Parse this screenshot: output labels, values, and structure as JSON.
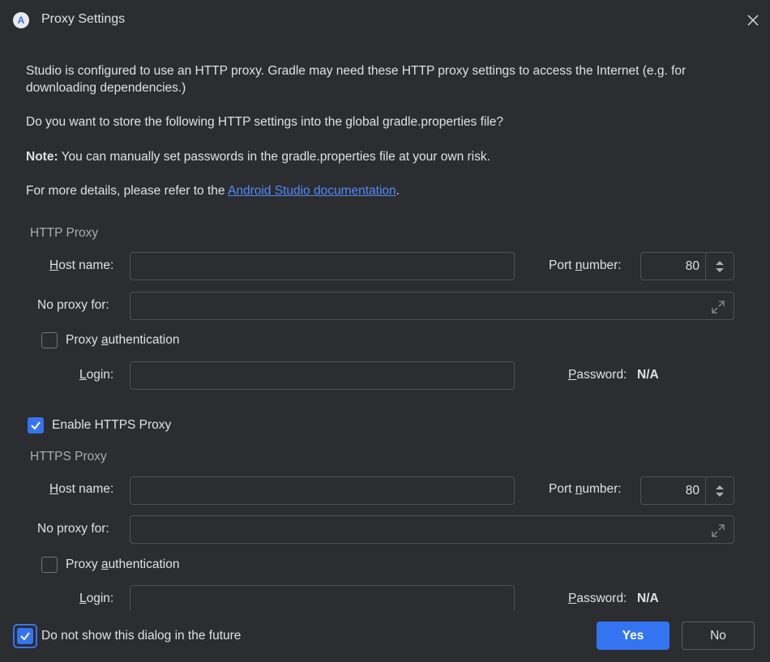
{
  "window": {
    "title": "Proxy Settings"
  },
  "description": {
    "line1": "Studio is configured to use an HTTP proxy. Gradle may need these HTTP proxy settings to access the Internet (e.g. for",
    "line2": "downloading dependencies.)",
    "question": "Do you want to store the following HTTP settings into the global gradle.properties file?",
    "note_bold": "Note:",
    "note_text": " You can manually set passwords in the gradle.properties file at your own risk.",
    "details_prefix": "For more details, please refer to the ",
    "details_link": "Android Studio documentation",
    "details_suffix": "."
  },
  "http": {
    "section_title": "HTTP Proxy",
    "host_label_u": "H",
    "host_label_rest": "ost name:",
    "host_value": "",
    "port_label_pre": "Port ",
    "port_label_u": "n",
    "port_label_rest": "umber:",
    "port_value": "80",
    "no_proxy_label": "No proxy for:",
    "no_proxy_value": "",
    "auth_label_pre": "Proxy ",
    "auth_label_u": "a",
    "auth_label_rest": "uthentication",
    "auth_checked": false,
    "login_label_u": "L",
    "login_label_rest": "ogin:",
    "login_value": "",
    "password_label_u": "P",
    "password_label_rest": "assword:",
    "password_value": "N/A"
  },
  "enable_https": {
    "label": "Enable HTTPS Proxy",
    "checked": true
  },
  "https": {
    "section_title": "HTTPS Proxy",
    "host_label_u": "H",
    "host_label_rest": "ost name:",
    "host_value": "",
    "port_label_pre": "Port ",
    "port_label_u": "n",
    "port_label_rest": "umber:",
    "port_value": "80",
    "no_proxy_label": "No proxy for:",
    "no_proxy_value": "",
    "auth_label_pre": "Proxy ",
    "auth_label_u": "a",
    "auth_label_rest": "uthentication",
    "auth_checked": false,
    "login_label_u": "L",
    "login_label_rest": "ogin:",
    "login_value": "",
    "password_label_u": "P",
    "password_label_rest": "assword:",
    "password_value": "N/A"
  },
  "footer": {
    "dont_show_label": "Do not show this dialog in the future",
    "dont_show_checked": true,
    "yes_label": "Yes",
    "no_label": "No"
  },
  "colors": {
    "accent": "#3574f0",
    "background": "#2b2d30",
    "link": "#548af7"
  },
  "icons": {
    "app": "android-studio-icon",
    "close": "close-icon",
    "expand": "expand-icon",
    "spinner": "spinner-arrows-icon",
    "check": "check-icon"
  }
}
